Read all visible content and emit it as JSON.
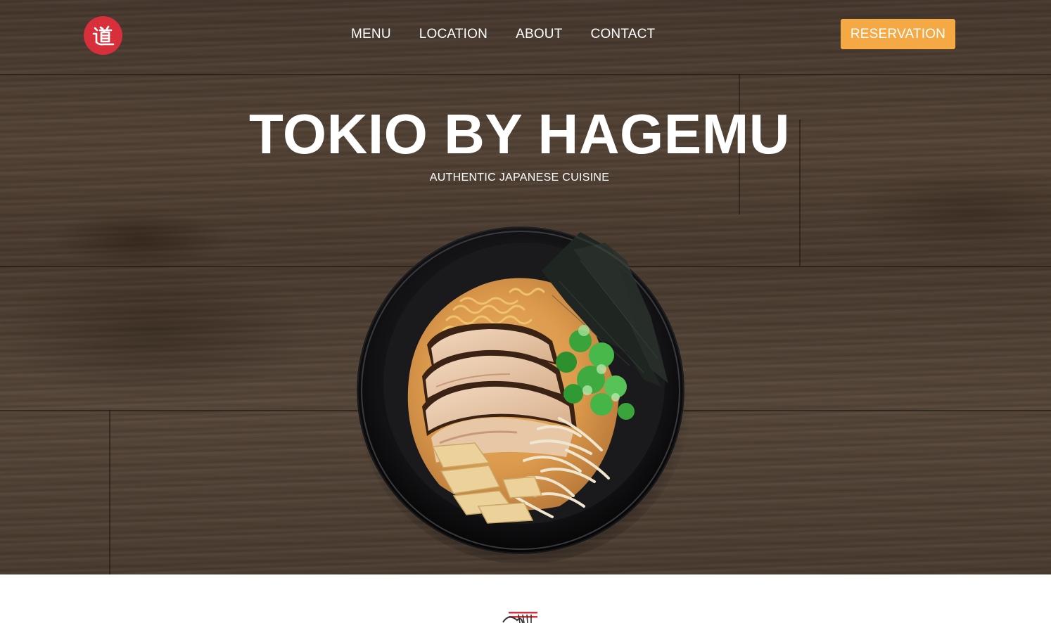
{
  "brand": {
    "logo_icon": "kanji-seal-logo",
    "logo_color": "#d7303a",
    "logo_glyph": "道"
  },
  "nav": {
    "items": [
      {
        "label": "MENU"
      },
      {
        "label": "LOCATION"
      },
      {
        "label": "ABOUT"
      },
      {
        "label": "CONTACT"
      }
    ]
  },
  "reservation": {
    "label": "RESERVATION",
    "color": "#f5a945"
  },
  "hero": {
    "title": "TOKIO BY HAGEMU",
    "subtitle": "AUTHENTIC JAPANESE CUISINE",
    "image": "ramen-bowl",
    "background": "dark-wood"
  },
  "section": {
    "icon": "noodle-bowl-icon"
  }
}
